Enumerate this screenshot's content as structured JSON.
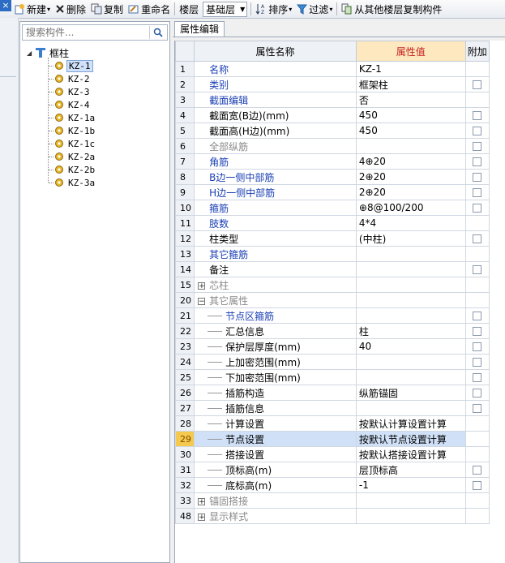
{
  "toolbar": {
    "close_glyph": "×",
    "new_label": "新建",
    "delete_label": "删除",
    "copy_label": "复制",
    "rename_label": "重命名",
    "floor_label": "楼层",
    "floor_value": "基础层",
    "sort_label": "排序",
    "filter_label": "过滤",
    "copy_from_floor_label": "从其他楼层复制构件"
  },
  "search": {
    "placeholder": "搜索构件..."
  },
  "tree": {
    "root_label": "框柱",
    "items": [
      "KZ-1",
      "KZ-2",
      "KZ-3",
      "KZ-4",
      "KZ-1a",
      "KZ-1b",
      "KZ-1c",
      "KZ-2a",
      "KZ-2b",
      "KZ-3a"
    ],
    "selected_index": 0
  },
  "props": {
    "tab_label": "属性编辑",
    "col_name": "属性名称",
    "col_value": "属性值",
    "col_extra": "附加",
    "rows": [
      {
        "num": "1",
        "name": "名称",
        "value": "KZ-1",
        "cb": false,
        "style": "blue"
      },
      {
        "num": "2",
        "name": "类别",
        "value": "框架柱",
        "cb": true,
        "style": "blue"
      },
      {
        "num": "3",
        "name": "截面编辑",
        "value": "否",
        "cb": false,
        "style": "blue"
      },
      {
        "num": "4",
        "name": "截面宽(B边)(mm)",
        "value": "450",
        "cb": true,
        "style": "normal"
      },
      {
        "num": "5",
        "name": "截面高(H边)(mm)",
        "value": "450",
        "cb": true,
        "style": "normal"
      },
      {
        "num": "6",
        "name": "全部纵筋",
        "value": "",
        "cb": true,
        "style": "gray"
      },
      {
        "num": "7",
        "name": "角筋",
        "value": "4⊕20",
        "cb": true,
        "style": "blue"
      },
      {
        "num": "8",
        "name": "B边一侧中部筋",
        "value": "2⊕20",
        "cb": true,
        "style": "blue"
      },
      {
        "num": "9",
        "name": "H边一侧中部筋",
        "value": "2⊕20",
        "cb": true,
        "style": "blue"
      },
      {
        "num": "10",
        "name": "箍筋",
        "value": "⊕8@100/200",
        "cb": true,
        "style": "blue"
      },
      {
        "num": "11",
        "name": "肢数",
        "value": "4*4",
        "cb": false,
        "style": "blue"
      },
      {
        "num": "12",
        "name": "柱类型",
        "value": "(中柱)",
        "cb": true,
        "style": "normal"
      },
      {
        "num": "13",
        "name": "其它箍筋",
        "value": "",
        "cb": false,
        "style": "blue"
      },
      {
        "num": "14",
        "name": "备注",
        "value": "",
        "cb": true,
        "style": "normal"
      },
      {
        "num": "15",
        "name": "芯柱",
        "value": "",
        "cb": false,
        "style": "group",
        "exp": "+"
      },
      {
        "num": "20",
        "name": "其它属性",
        "value": "",
        "cb": false,
        "style": "group",
        "exp": "−"
      },
      {
        "num": "21",
        "name": "节点区箍筋",
        "value": "",
        "cb": true,
        "style": "sub-blue"
      },
      {
        "num": "22",
        "name": "汇总信息",
        "value": "柱",
        "cb": true,
        "style": "sub"
      },
      {
        "num": "23",
        "name": "保护层厚度(mm)",
        "value": "40",
        "cb": true,
        "style": "sub"
      },
      {
        "num": "24",
        "name": "上加密范围(mm)",
        "value": "",
        "cb": true,
        "style": "sub"
      },
      {
        "num": "25",
        "name": "下加密范围(mm)",
        "value": "",
        "cb": true,
        "style": "sub"
      },
      {
        "num": "26",
        "name": "插筋构造",
        "value": "纵筋锚固",
        "cb": true,
        "style": "sub"
      },
      {
        "num": "27",
        "name": "插筋信息",
        "value": "",
        "cb": true,
        "style": "sub"
      },
      {
        "num": "28",
        "name": "计算设置",
        "value": "按默认计算设置计算",
        "cb": false,
        "style": "sub"
      },
      {
        "num": "29",
        "name": "节点设置",
        "value": "按默认节点设置计算",
        "cb": false,
        "style": "sub",
        "selected": true
      },
      {
        "num": "30",
        "name": "搭接设置",
        "value": "按默认搭接设置计算",
        "cb": false,
        "style": "sub"
      },
      {
        "num": "31",
        "name": "顶标高(m)",
        "value": "层顶标高",
        "cb": true,
        "style": "sub"
      },
      {
        "num": "32",
        "name": "底标高(m)",
        "value": "-1",
        "cb": true,
        "style": "sub"
      },
      {
        "num": "33",
        "name": "锚固搭接",
        "value": "",
        "cb": false,
        "style": "group",
        "exp": "+"
      },
      {
        "num": "48",
        "name": "显示样式",
        "value": "",
        "cb": false,
        "style": "group",
        "exp": "+"
      }
    ]
  }
}
